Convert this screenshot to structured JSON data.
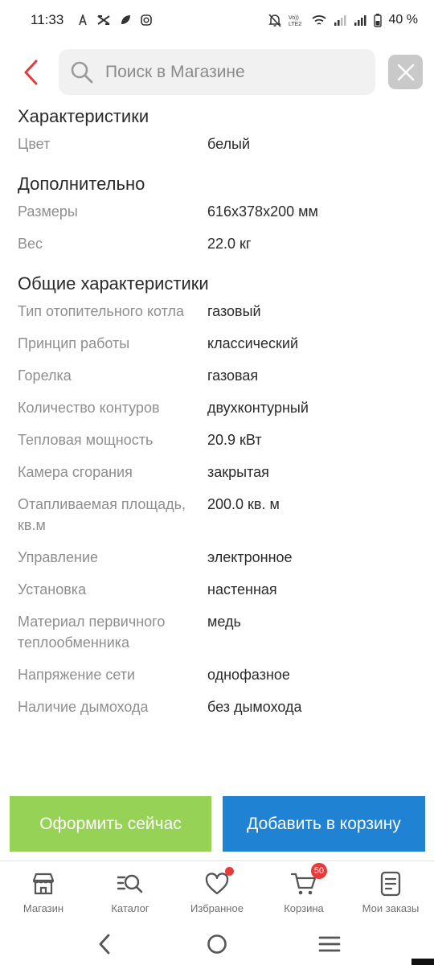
{
  "status_bar": {
    "time": "11:33",
    "battery_percent": "40 %",
    "network_label": "Vo)) LTE2"
  },
  "header": {
    "search_placeholder": "Поиск в Магазине"
  },
  "sections": [
    {
      "title": "Характеристики",
      "rows": [
        {
          "label": "Цвет",
          "value": "белый"
        }
      ]
    },
    {
      "title": "Дополнительно",
      "rows": [
        {
          "label": "Размеры",
          "value": "616x378x200 мм"
        },
        {
          "label": "Вес",
          "value": "22.0 кг"
        }
      ]
    },
    {
      "title": "Общие характеристики",
      "rows": [
        {
          "label": "Тип отопительного котла",
          "value": "газовый"
        },
        {
          "label": "Принцип работы",
          "value": "классический"
        },
        {
          "label": "Горелка",
          "value": "газовая"
        },
        {
          "label": "Количество контуров",
          "value": "двухконтурный"
        },
        {
          "label": "Тепловая мощность",
          "value": "20.9 кВт"
        },
        {
          "label": "Камера сгорания",
          "value": "закрытая"
        },
        {
          "label": "Отапливаемая площадь, кв.м",
          "value": "200.0 кв. м"
        },
        {
          "label": "Управление",
          "value": "электронное"
        },
        {
          "label": "Установка",
          "value": "настенная"
        },
        {
          "label": "Материал первичного теплообменника",
          "value": "медь"
        },
        {
          "label": "Напряжение сети",
          "value": "однофазное"
        },
        {
          "label": "Наличие дымохода",
          "value": "без дымохода"
        }
      ]
    }
  ],
  "actions": {
    "checkout_label": "Оформить сейчас",
    "add_to_cart_label": "Добавить в корзину"
  },
  "tabs": [
    {
      "label": "Магазин",
      "icon": "store-icon"
    },
    {
      "label": "Каталог",
      "icon": "catalog-search-icon"
    },
    {
      "label": "Избранное",
      "icon": "heart-icon"
    },
    {
      "label": "Корзина",
      "icon": "cart-icon",
      "badge": "50"
    },
    {
      "label": "Мои заказы",
      "icon": "orders-icon"
    }
  ],
  "colors": {
    "accent_red": "#e83a3a",
    "checkout_green": "#96d255",
    "cart_blue": "#1f82d2"
  }
}
